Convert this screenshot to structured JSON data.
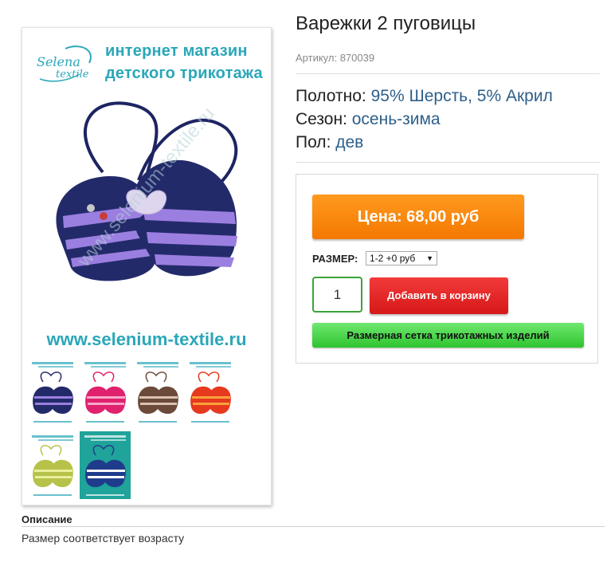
{
  "gallery": {
    "brand": {
      "line1": "Selena",
      "line2": "textile"
    },
    "store_line1": "интернет магазин",
    "store_line2": "детского трикотажа",
    "website": "www.selenium-textile.ru",
    "watermark": "www.selenium-textile.ru",
    "thumbnails": [
      {
        "name": "thumb-navy-lilac",
        "bg": "#ffffff",
        "c1": "#232a6a",
        "c2": "#9b7fe0"
      },
      {
        "name": "thumb-pink",
        "bg": "#ffffff",
        "c1": "#e0226e",
        "c2": "#f7a8c8"
      },
      {
        "name": "thumb-brown-beige",
        "bg": "#ffffff",
        "c1": "#6b4a3a",
        "c2": "#d9c3b0"
      },
      {
        "name": "thumb-orange-red",
        "bg": "#ffffff",
        "c1": "#e6391e",
        "c2": "#f7a23a"
      },
      {
        "name": "thumb-olive",
        "bg": "#ffffff",
        "c1": "#b7c24a",
        "c2": "#e9ef9a"
      },
      {
        "name": "thumb-teal-navy",
        "bg": "#1fa39a",
        "c1": "#1f3c8c",
        "c2": "#ffffff"
      }
    ]
  },
  "product": {
    "title": "Варежки 2 пуговицы",
    "sku": "Артикул: 870039",
    "attributes": [
      {
        "key": "Полотно:",
        "value": "95% Шерсть, 5% Акрил"
      },
      {
        "key": "Сезон:",
        "value": "осень-зима"
      },
      {
        "key": "Пол:",
        "value": "дев"
      }
    ]
  },
  "buy": {
    "price_label": "Цена: 68,00 руб",
    "size_label": "РАЗМЕР:",
    "size_selected": "1-2 +0 руб",
    "qty": "1",
    "add_to_cart": "Добавить в корзину",
    "size_chart": "Размерная сетка трикотажных изделий"
  },
  "description": {
    "heading": "Описание",
    "text": "Размер соответствует возрасту"
  },
  "colors": {
    "accent": "#2aa7b8",
    "price_button": "#f47800",
    "cart_button": "#d61818",
    "size_chart_button": "#2fc42f",
    "attr_value": "#2d5f8a"
  }
}
